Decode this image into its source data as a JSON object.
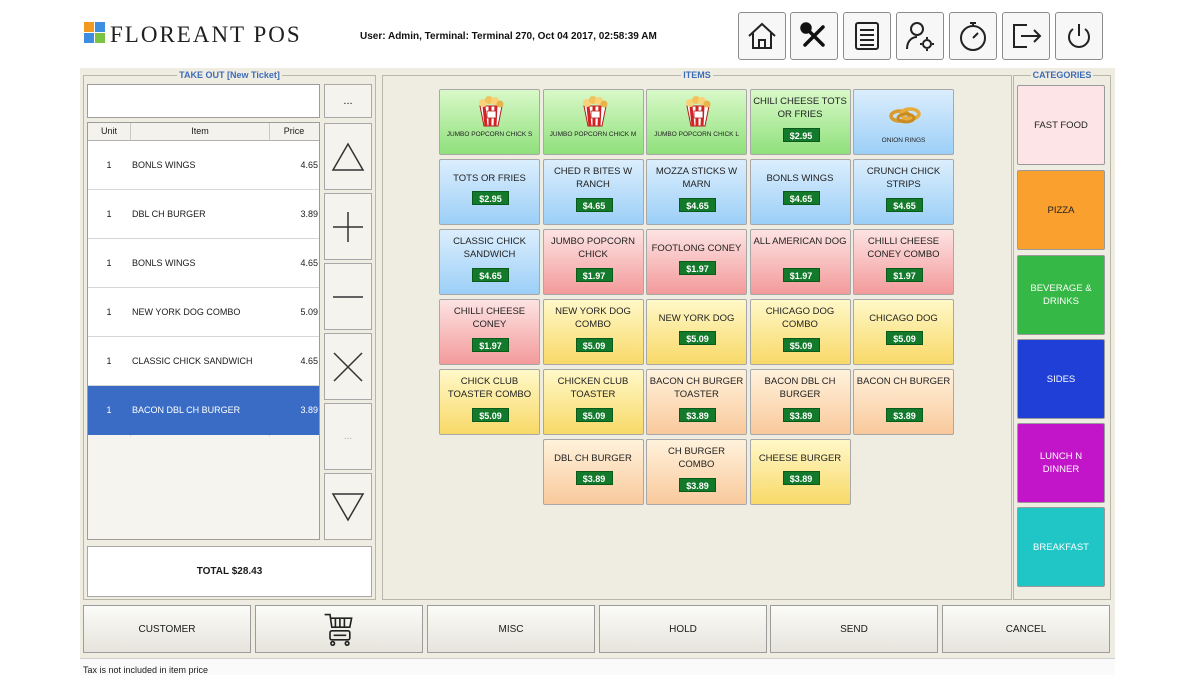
{
  "app": {
    "brand": "FLOREANT POS",
    "status": "User: Admin, Terminal: Terminal 270, Oct 04 2017, 02:58:39 AM"
  },
  "toolbar": [
    {
      "name": "home-button",
      "icon": "home-icon"
    },
    {
      "name": "tools-button",
      "icon": "tools-icon"
    },
    {
      "name": "orders-list-button",
      "icon": "list-icon"
    },
    {
      "name": "user-settings-button",
      "icon": "user-gear-icon"
    },
    {
      "name": "clock-button",
      "icon": "stopwatch-icon"
    },
    {
      "name": "logout-button",
      "icon": "logout-icon"
    },
    {
      "name": "power-button",
      "icon": "power-icon"
    }
  ],
  "ticket": {
    "title": "TAKE OUT [New Ticket]",
    "more_label": "...",
    "headers": {
      "unit": "Unit",
      "item": "Item",
      "price": "Price"
    },
    "rows": [
      {
        "unit": "1",
        "item": "BONLS WINGS",
        "price": "4.65"
      },
      {
        "unit": "1",
        "item": "DBL CH BURGER",
        "price": "3.89"
      },
      {
        "unit": "1",
        "item": "BONLS WINGS",
        "price": "4.65"
      },
      {
        "unit": "1",
        "item": "NEW YORK DOG COMBO",
        "price": "5.09"
      },
      {
        "unit": "1",
        "item": "CLASSIC CHICK SANDWICH",
        "price": "4.65"
      },
      {
        "unit": "1",
        "item": "BACON DBL CH BURGER",
        "price": "3.89"
      }
    ],
    "controls": {
      "blank": "..."
    },
    "total": "TOTAL $28.43"
  },
  "items_title": "ITEMS",
  "items": [
    {
      "name": "JUMBO POPCORN CHICK S",
      "price": "",
      "image": "popcorn-chicken-image",
      "color": "green"
    },
    {
      "name": "JUMBO POPCORN CHICK M",
      "price": "",
      "image": "popcorn-chicken-image",
      "color": "green"
    },
    {
      "name": "JUMBO POPCORN CHICK L",
      "price": "",
      "image": "popcorn-chicken-image",
      "color": "green"
    },
    {
      "name": "CHILI CHEESE TOTS OR FRIES",
      "price": "$2.95",
      "color": "green"
    },
    {
      "name": "ONION RINGS",
      "price": "",
      "image": "onion-rings-image",
      "color": "blue"
    },
    {
      "name": "TOTS OR FRIES",
      "price": "$2.95",
      "color": "blue"
    },
    {
      "name": "CHED R BITES W RANCH",
      "price": "$4.65",
      "color": "blue"
    },
    {
      "name": "MOZZA STICKS W MARN",
      "price": "$4.65",
      "color": "blue"
    },
    {
      "name": "BONLS WINGS",
      "price": "$4.65",
      "color": "blue"
    },
    {
      "name": "CRUNCH CHICK STRIPS",
      "price": "$4.65",
      "color": "blue"
    },
    {
      "name": "CLASSIC CHICK SANDWICH",
      "price": "$4.65",
      "color": "blue"
    },
    {
      "name": "JUMBO POPCORN CHICK",
      "price": "$1.97",
      "color": "red"
    },
    {
      "name": "FOOTLONG CONEY",
      "price": "$1.97",
      "color": "red"
    },
    {
      "name": "ALL AMERICAN DOG",
      "price": "$1.97",
      "color": "red"
    },
    {
      "name": "CHILLI CHEESE CONEY COMBO",
      "price": "$1.97",
      "color": "red"
    },
    {
      "name": "CHILLI CHEESE CONEY",
      "price": "$1.97",
      "color": "red"
    },
    {
      "name": "NEW YORK DOG COMBO",
      "price": "$5.09",
      "color": "yellow"
    },
    {
      "name": "NEW YORK DOG",
      "price": "$5.09",
      "color": "yellow"
    },
    {
      "name": "CHICAGO DOG COMBO",
      "price": "$5.09",
      "color": "yellow"
    },
    {
      "name": "CHICAGO DOG",
      "price": "$5.09",
      "color": "yellow"
    },
    {
      "name": "CHICK CLUB TOASTER COMBO",
      "price": "$5.09",
      "color": "yellow"
    },
    {
      "name": "CHICKEN CLUB TOASTER",
      "price": "$5.09",
      "color": "yellow"
    },
    {
      "name": "BACON CH BURGER TOASTER",
      "price": "$3.89",
      "color": "orange"
    },
    {
      "name": "BACON DBL CH BURGER",
      "price": "$3.89",
      "color": "orange"
    },
    {
      "name": "BACON CH BURGER",
      "price": "$3.89",
      "color": "orange"
    },
    {
      "name": "DBL CH BURGER",
      "price": "$3.89",
      "color": "orange"
    },
    {
      "name": "CH BURGER COMBO",
      "price": "$3.89",
      "color": "orange"
    },
    {
      "name": "CHEESE BURGER",
      "price": "$3.89",
      "color": "yellow"
    }
  ],
  "categories_title": "CATEGORIES",
  "categories": [
    {
      "label": "FAST FOOD",
      "color": "#fde4e6",
      "text_color": "#222222"
    },
    {
      "label": "PIZZA",
      "color": "#f9a02e",
      "text_color": "#222222"
    },
    {
      "label": "BEVERAGE & DRINKS",
      "color": "#35b845",
      "text_color": "#ffffff"
    },
    {
      "label": "SIDES",
      "color": "#1f3fd6",
      "text_color": "#ffffff"
    },
    {
      "label": "LUNCH N DINNER",
      "color": "#c214c9",
      "text_color": "#ffffff"
    },
    {
      "label": "BREAKFAST",
      "color": "#20c5c6",
      "text_color": "#ffffff"
    }
  ],
  "bottom": {
    "customer": "CUSTOMER",
    "misc": "MISC",
    "hold": "HOLD",
    "send": "SEND",
    "cancel": "CANCEL"
  },
  "footer": "Tax is not included in item price"
}
